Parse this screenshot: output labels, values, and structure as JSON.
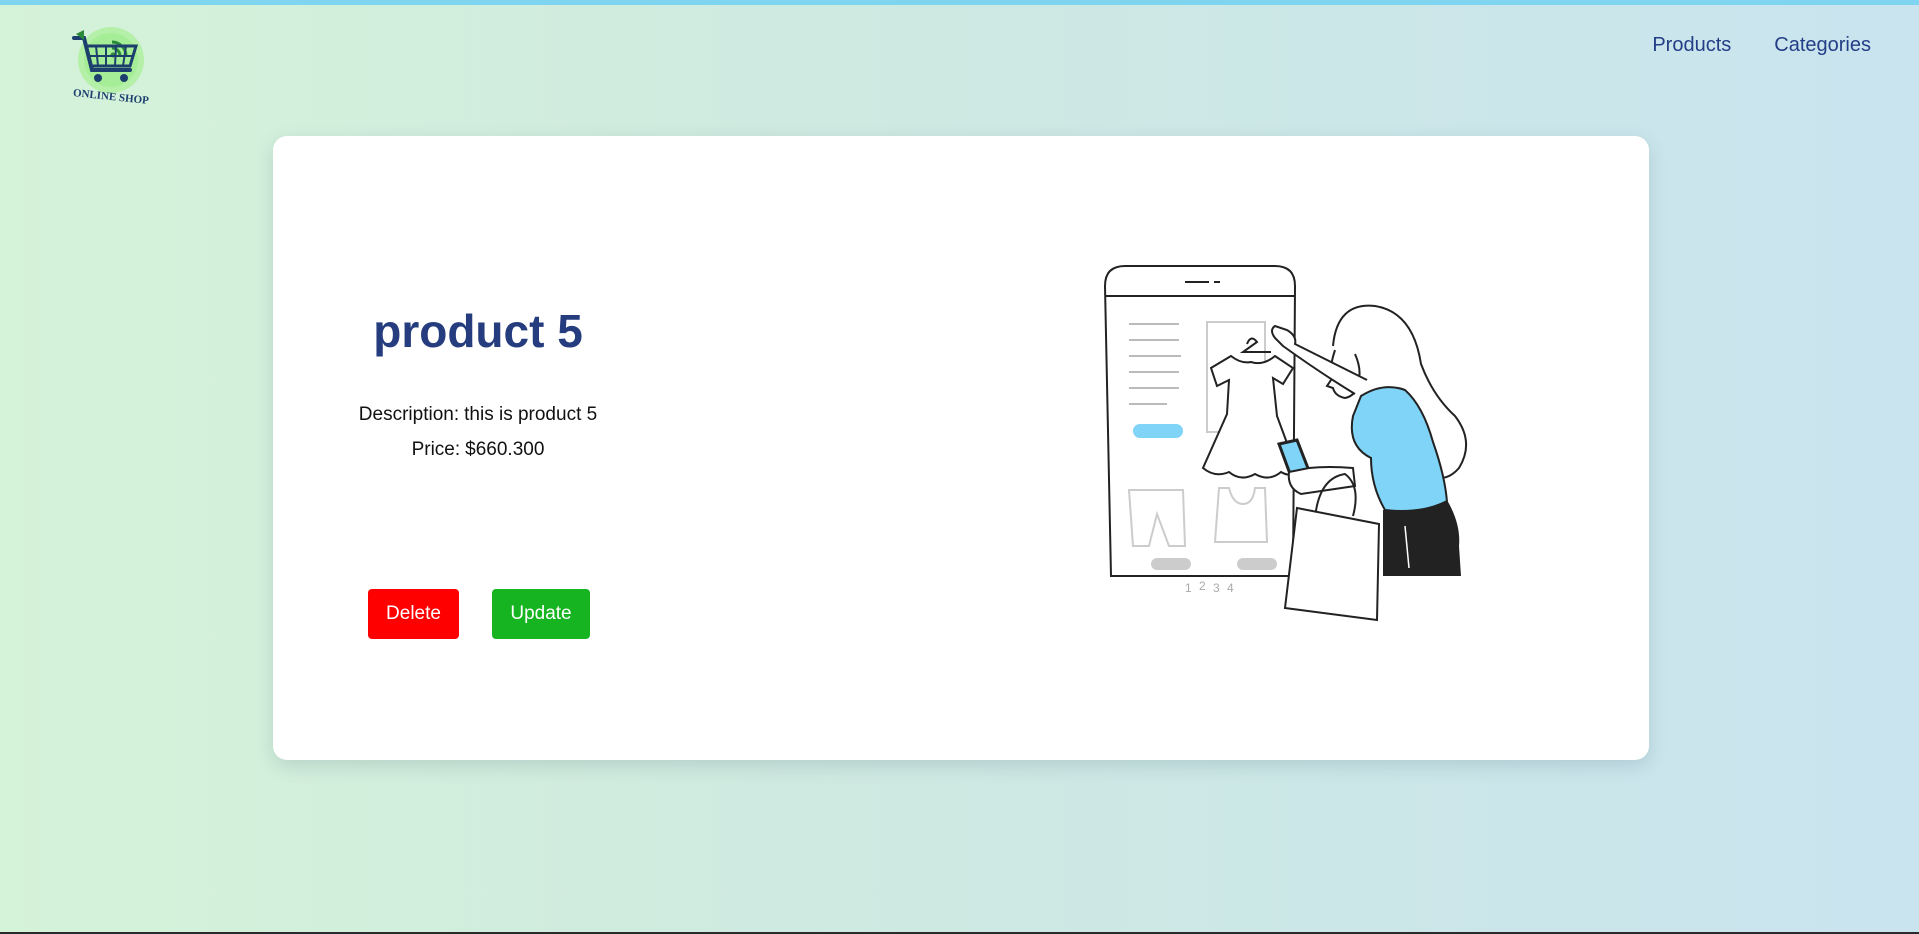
{
  "header": {
    "logo_text": "ONLINE SHOP",
    "nav": [
      {
        "label": "Products"
      },
      {
        "label": "Categories"
      }
    ]
  },
  "product": {
    "title": "product 5",
    "description_label": "Description:",
    "description": "this is product 5",
    "price_label": "Price:",
    "price": "$660.300"
  },
  "actions": {
    "delete_label": "Delete",
    "update_label": "Update"
  },
  "illustration": {
    "page_numbers": [
      "1",
      "2",
      "3",
      "4"
    ]
  },
  "colors": {
    "accent_blue": "#233e86",
    "delete_red": "#ff0000",
    "update_green": "#16b421",
    "shirt_blue": "#7fd4f7"
  }
}
